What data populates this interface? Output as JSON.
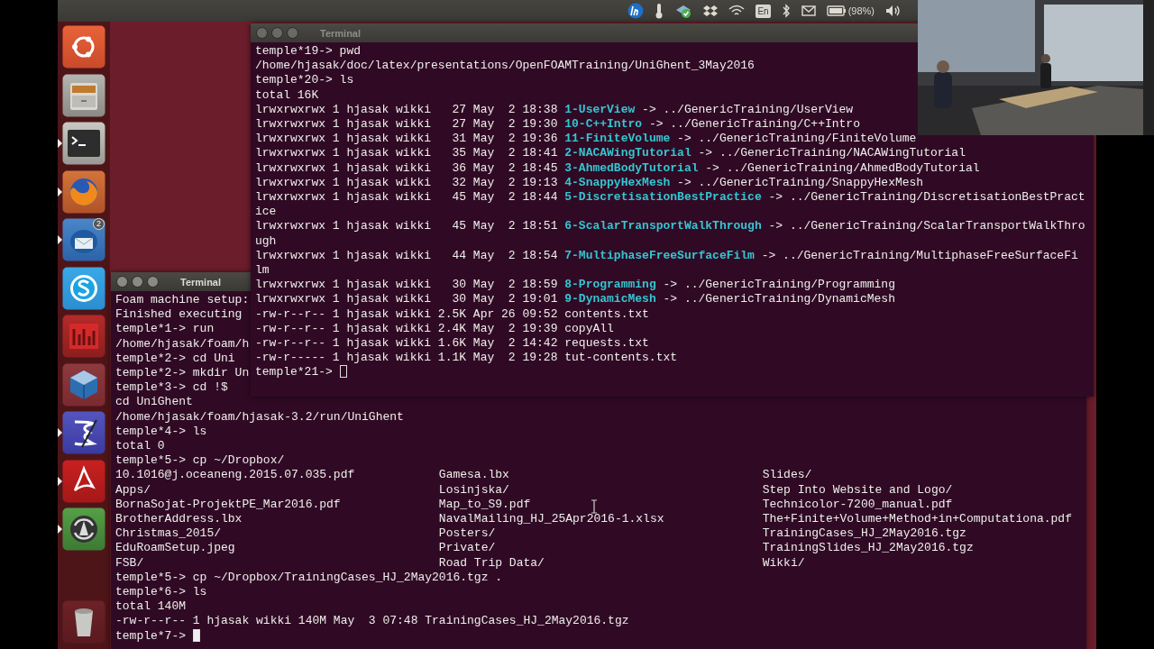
{
  "panel": {
    "keyboard_layout": "En",
    "battery": "(98%)"
  },
  "launcher": {
    "items": [
      {
        "kind": "ubuntu",
        "running": false
      },
      {
        "kind": "files",
        "running": false
      },
      {
        "kind": "terminal",
        "running": true
      },
      {
        "kind": "firefox",
        "running": true
      },
      {
        "kind": "mail",
        "running": true,
        "badge": "2"
      },
      {
        "kind": "skype",
        "running": false
      },
      {
        "kind": "mendeley",
        "running": false
      },
      {
        "kind": "virtualbox",
        "running": false
      },
      {
        "kind": "emacs",
        "running": true
      },
      {
        "kind": "acrobat",
        "running": true
      },
      {
        "kind": "updater",
        "running": true
      },
      {
        "kind": "trash",
        "running": false
      }
    ]
  },
  "windows": [
    {
      "title": "Terminal",
      "focused": true,
      "lines": [
        {
          "kind": "text",
          "text": "Foam machine setup:"
        },
        {
          "kind": "text",
          "text": "Finished executing"
        },
        {
          "kind": "text",
          "text": "temple*1-> run"
        },
        {
          "kind": "text",
          "text": "/home/hjasak/foam/h"
        },
        {
          "kind": "text",
          "text": "temple*2-> cd Uni"
        },
        {
          "kind": "text",
          "text": "temple*2-> mkdir Un"
        },
        {
          "kind": "text",
          "text": "temple*3-> cd !$"
        },
        {
          "kind": "text",
          "text": "cd UniGhent"
        },
        {
          "kind": "text",
          "text": "/home/hjasak/foam/hjasak-3.2/run/UniGhent"
        },
        {
          "kind": "text",
          "text": "temple*4-> ls"
        },
        {
          "kind": "text",
          "text": "total 0"
        },
        {
          "kind": "text",
          "text": "temple*5-> cp ~/Dropbox/"
        },
        {
          "kind": "columns",
          "cells": [
            "10.1016@j.oceaneng.2015.07.035.pdf",
            "Gamesa.lbx",
            "Slides/"
          ]
        },
        {
          "kind": "columns",
          "cells": [
            "Apps/",
            "Losinjska/",
            "Step Into Website and Logo/"
          ]
        },
        {
          "kind": "columns",
          "cells": [
            "BornaSojat-ProjektPE_Mar2016.pdf",
            "Map_to_S9.pdf",
            "Technicolor-7200_manual.pdf"
          ]
        },
        {
          "kind": "columns",
          "cells": [
            "BrotherAddress.lbx",
            "NavalMailing_HJ_25Apr2016-1.xlsx",
            "The+Finite+Volume+Method+in+Computationa.pdf"
          ]
        },
        {
          "kind": "columns",
          "cells": [
            "Christmas_2015/",
            "Posters/",
            "TrainingCases_HJ_2May2016.tgz"
          ]
        },
        {
          "kind": "columns",
          "cells": [
            "EduRoamSetup.jpeg",
            "Private/",
            "TrainingSlides_HJ_2May2016.tgz"
          ]
        },
        {
          "kind": "columns",
          "cells": [
            "FSB/",
            "Road Trip Data/",
            "Wikki/"
          ]
        },
        {
          "kind": "text",
          "text": "temple*5-> cp ~/Dropbox/TrainingCases_HJ_2May2016.tgz ."
        },
        {
          "kind": "text",
          "text": "temple*6-> ls"
        },
        {
          "kind": "text",
          "text": "total 140M"
        },
        {
          "kind": "text",
          "text": "-rw-r--r-- 1 hjasak wikki 140M May  3 07:48 TrainingCases_HJ_2May2016.tgz"
        },
        {
          "kind": "prompt",
          "text": "temple*7->"
        }
      ]
    },
    {
      "title": "Terminal",
      "focused": false,
      "lines": [
        {
          "kind": "text",
          "text": "temple*19-> pwd"
        },
        {
          "kind": "text",
          "text": "/home/hjasak/doc/latex/presentations/OpenFOAMTraining/UniGhent_3May2016"
        },
        {
          "kind": "text",
          "text": "temple*20-> ls"
        },
        {
          "kind": "text",
          "text": "total 16K"
        },
        {
          "kind": "symlink",
          "head": "lrwxrwxrwx 1 hjasak wikki   27 May  2 18:38",
          "name": "1-UserView",
          "tail": "-> ../GenericTraining/UserView"
        },
        {
          "kind": "symlink",
          "head": "lrwxrwxrwx 1 hjasak wikki   27 May  2 19:30",
          "name": "10-C++Intro",
          "tail": "-> ../GenericTraining/C++Intro"
        },
        {
          "kind": "symlink",
          "head": "lrwxrwxrwx 1 hjasak wikki   31 May  2 19:36",
          "name": "11-FiniteVolume",
          "tail": "-> ../GenericTraining/FiniteVolume"
        },
        {
          "kind": "symlink",
          "head": "lrwxrwxrwx 1 hjasak wikki   35 May  2 18:41",
          "name": "2-NACAWingTutorial",
          "tail": "-> ../GenericTraining/NACAWingTutorial"
        },
        {
          "kind": "symlink",
          "head": "lrwxrwxrwx 1 hjasak wikki   36 May  2 18:45",
          "name": "3-AhmedBodyTutorial",
          "tail": "-> ../GenericTraining/AhmedBodyTutorial"
        },
        {
          "kind": "symlink",
          "head": "lrwxrwxrwx 1 hjasak wikki   32 May  2 19:13",
          "name": "4-SnappyHexMesh",
          "tail": "-> ../GenericTraining/SnappyHexMesh"
        },
        {
          "kind": "symlink",
          "head": "lrwxrwxrwx 1 hjasak wikki   45 May  2 18:44",
          "name": "5-DiscretisationBestPractice",
          "tail": "-> ../GenericTraining/DiscretisationBestPractice"
        },
        {
          "kind": "symlink",
          "head": "lrwxrwxrwx 1 hjasak wikki   45 May  2 18:51",
          "name": "6-ScalarTransportWalkThrough",
          "tail": "-> ../GenericTraining/ScalarTransportWalkThrough"
        },
        {
          "kind": "symlink",
          "head": "lrwxrwxrwx 1 hjasak wikki   44 May  2 18:54",
          "name": "7-MultiphaseFreeSurfaceFilm",
          "tail": "-> ../GenericTraining/MultiphaseFreeSurfaceFilm"
        },
        {
          "kind": "symlink",
          "head": "lrwxrwxrwx 1 hjasak wikki   30 May  2 18:59",
          "name": "8-Programming",
          "tail": "-> ../GenericTraining/Programming"
        },
        {
          "kind": "symlink",
          "head": "lrwxrwxrwx 1 hjasak wikki   30 May  2 19:01",
          "name": "9-DynamicMesh",
          "tail": "-> ../GenericTraining/DynamicMesh"
        },
        {
          "kind": "text",
          "text": "-rw-r--r-- 1 hjasak wikki 2.5K Apr 26 09:52 contents.txt"
        },
        {
          "kind": "text",
          "text": "-rw-r--r-- 1 hjasak wikki 2.4K May  2 19:39 copyAll"
        },
        {
          "kind": "text",
          "text": "-rw-r--r-- 1 hjasak wikki 1.6K May  2 14:42 requests.txt"
        },
        {
          "kind": "text",
          "text": "-rw-r----- 1 hjasak wikki 1.1K May  2 19:28 tut-contents.txt"
        },
        {
          "kind": "prompt",
          "text": "temple*21->"
        }
      ]
    }
  ]
}
